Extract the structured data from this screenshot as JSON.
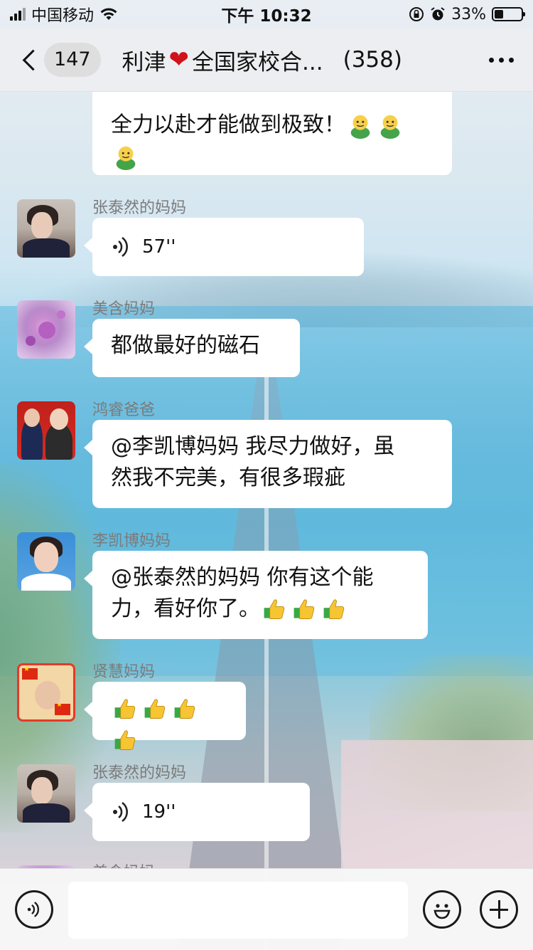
{
  "status_bar": {
    "carrier": "中国移动",
    "time": "下午 10:32",
    "battery_percent": "33%",
    "battery_level": 0.33
  },
  "nav": {
    "back_count": "147",
    "title_prefix": "利津",
    "title_suffix": "全国家校合...",
    "member_count": "(358)"
  },
  "messages": [
    {
      "type": "text_partial",
      "lines": [
        "全力以赴才能做到极致！"
      ]
    },
    {
      "type": "voice",
      "sender": "张泰然的妈妈",
      "duration": "57''"
    },
    {
      "type": "text",
      "sender": "美含妈妈",
      "text": "都做最好的磁石"
    },
    {
      "type": "text",
      "sender": "鸿睿爸爸",
      "line1": "@李凯博妈妈 我尽力做好，虽",
      "line2": "然我不完美，有很多瑕疵"
    },
    {
      "type": "text",
      "sender": "李凯博妈妈",
      "line1": "@张泰然的妈妈 你有这个能",
      "line2": "力，看好你了。"
    },
    {
      "type": "emoji",
      "sender": "贤慧妈妈"
    },
    {
      "type": "voice",
      "sender": "张泰然的妈妈",
      "duration": "19''"
    },
    {
      "type": "partial",
      "sender": "美含妈妈"
    }
  ],
  "colors": {
    "nav_bg": "#ededf0",
    "bubble_bg": "#ffffff",
    "sender_name": "#7b7b7b"
  }
}
